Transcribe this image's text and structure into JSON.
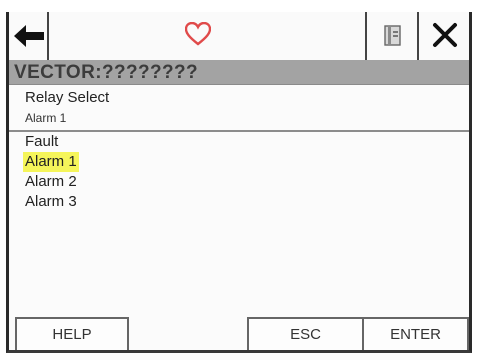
{
  "toolbar": {
    "back_icon": "left-arrow-icon",
    "favorite_icon": "heart-icon",
    "manual_icon": "book-icon",
    "close_icon": "close-icon",
    "heart_color": "#e04a4a"
  },
  "header": {
    "title": "VECTOR:????????"
  },
  "parameter": {
    "label": "Relay Select",
    "current_value": "Alarm 1"
  },
  "options": [
    "Fault",
    "Alarm 1",
    "Alarm 2",
    "Alarm 3"
  ],
  "selected_option": "Alarm 1",
  "highlight_color": "#f5f55a",
  "softkeys": {
    "help": "HELP",
    "esc": "ESC",
    "enter": "ENTER"
  }
}
